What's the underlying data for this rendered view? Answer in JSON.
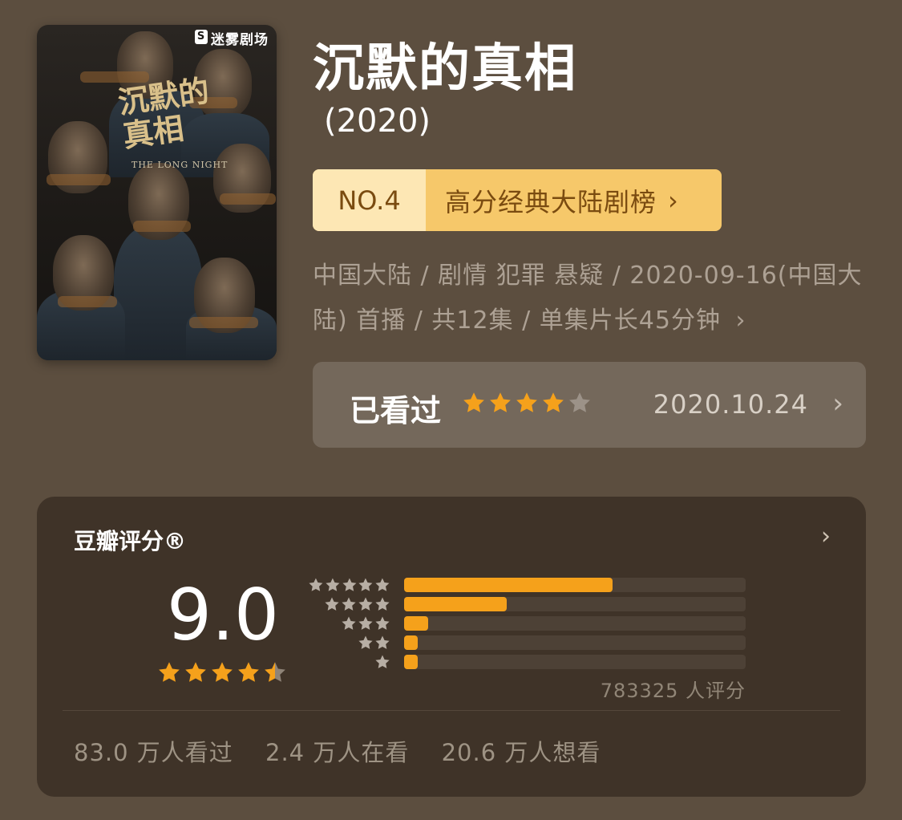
{
  "poster": {
    "brand": "迷雾剧场",
    "title_art": "沉默的真相",
    "english_title": "THE LONG NIGHT"
  },
  "title": "沉默的真相",
  "year": "(2020)",
  "rank": {
    "number": "NO.4",
    "list_name": "高分经典大陆剧榜",
    "chevron": "›"
  },
  "meta": {
    "text": "中国大陆 / 剧情 犯罪 悬疑 / 2020-09-16(中国大陆) 首播 / 共12集 / 单集片长45分钟",
    "chevron": "›"
  },
  "watched": {
    "label": "已看过",
    "user_stars": 4,
    "date": "2020.10.24",
    "chevron": "›"
  },
  "rating": {
    "title": "豆瓣评分®",
    "chevron": "›",
    "score": "9.0",
    "stars": 4.5,
    "distribution": [
      {
        "stars": 5,
        "percent": 61
      },
      {
        "stars": 4,
        "percent": 30
      },
      {
        "stars": 3,
        "percent": 7
      },
      {
        "stars": 2,
        "percent": 4
      },
      {
        "stars": 1,
        "percent": 4
      }
    ],
    "count": "783325 人评分",
    "stats": [
      "83.0 万人看过",
      "2.4 万人在看",
      "20.6 万人想看"
    ]
  },
  "colors": {
    "background": "#5c4e3f",
    "accent": "#f5a11b",
    "card": "#3f3328"
  }
}
